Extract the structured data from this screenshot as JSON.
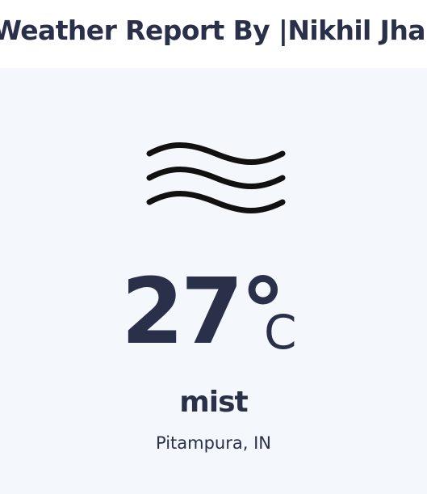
{
  "header": {
    "title": "Weather Report By |Nikhil Jha|"
  },
  "weather": {
    "icon": "mist-icon",
    "temperature": "27°",
    "unit": "C",
    "condition": "mist",
    "location": "Pitampura, IN"
  },
  "colors": {
    "text": "#2a2f4a",
    "card_background": "#f4f7fc",
    "page_background": "#ffffff"
  }
}
